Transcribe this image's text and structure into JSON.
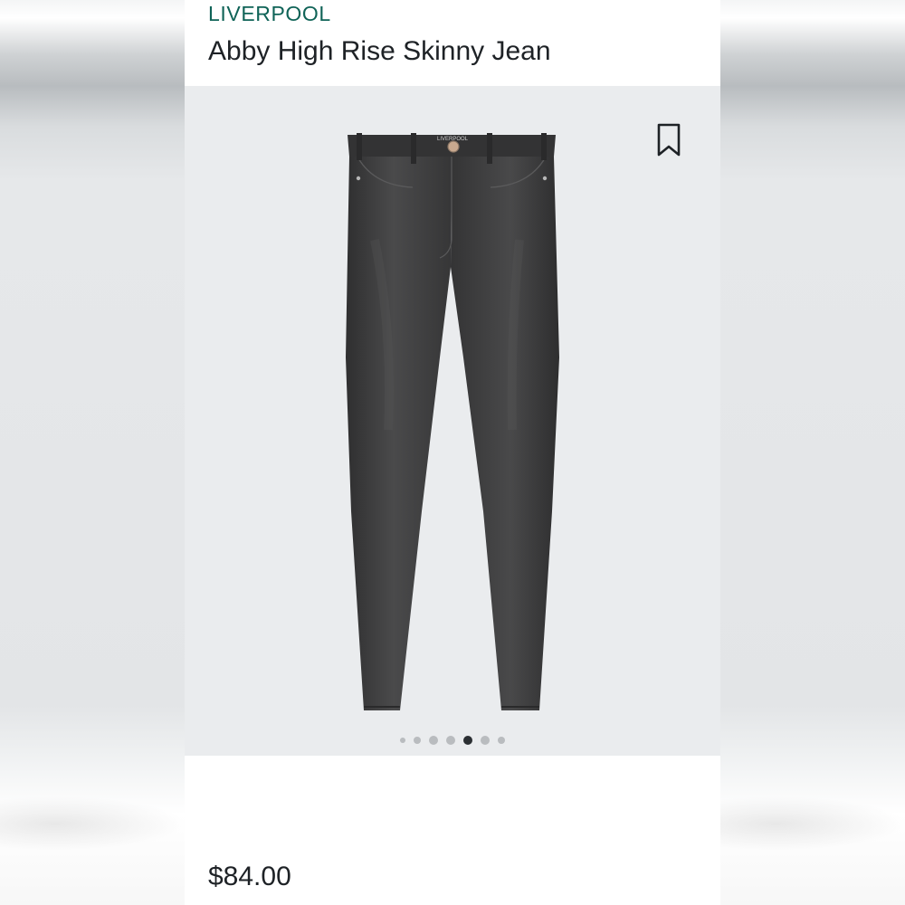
{
  "product": {
    "brand": "LIVERPOOL",
    "name": "Abby High Rise Skinny Jean",
    "price": "$84.00",
    "waistband_label": "LIVERPOOL"
  },
  "gallery": {
    "image_count": 7,
    "active_index": 4
  },
  "icons": {
    "save": "bookmark-icon"
  },
  "colors": {
    "brand": "#0f6357",
    "text": "#1e2226",
    "image_bg": "#eaecee",
    "denim": "#3c3c3d",
    "dot": "#b9bcbf",
    "dot_active": "#2b2f33"
  }
}
